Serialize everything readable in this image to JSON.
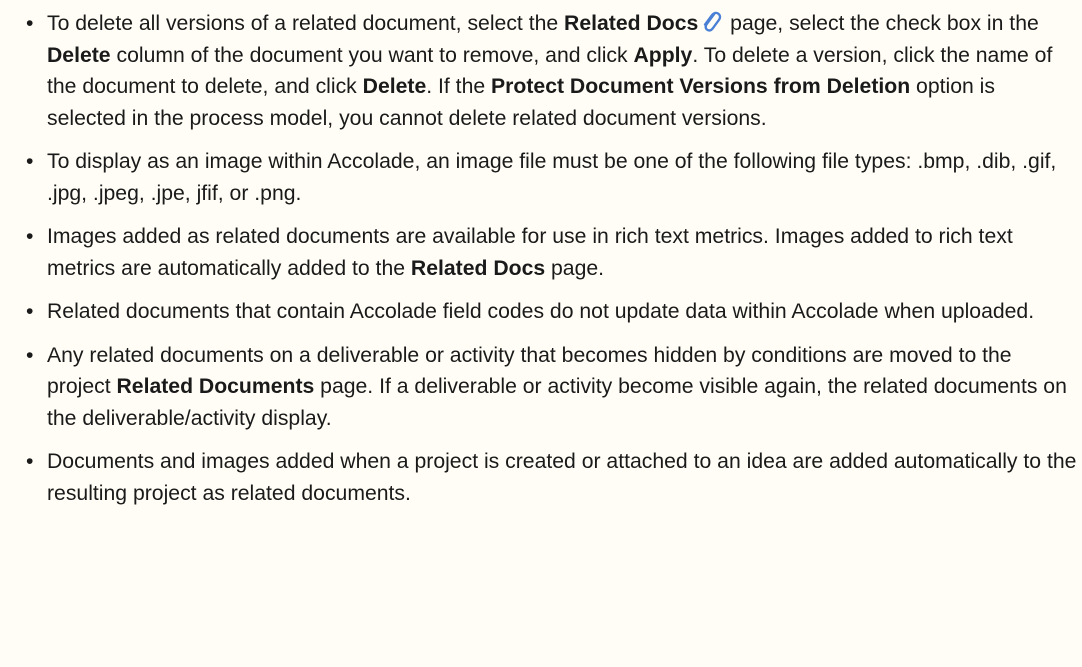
{
  "bullets": [
    {
      "segments": [
        {
          "t": "To delete all versions of a related document, select the "
        },
        {
          "t": "Related Docs",
          "b": true
        },
        {
          "icon": "paperclip-icon"
        },
        {
          "t": " page, select the check box in the "
        },
        {
          "t": "Delete",
          "b": true
        },
        {
          "t": " column of the document you want to remove, and click "
        },
        {
          "t": "Apply",
          "b": true
        },
        {
          "t": ". To delete a version, click the name of the document to delete, and click "
        },
        {
          "t": "Delete",
          "b": true
        },
        {
          "t": ". If the "
        },
        {
          "t": "Protect Document Versions from Deletion",
          "b": true
        },
        {
          "t": " option is selected in the process model, you cannot delete related document versions."
        }
      ]
    },
    {
      "segments": [
        {
          "t": "To display as an image within Accolade, an image file must be one of the following file types: .bmp, .dib, .gif, .jpg, .jpeg, .jpe, jfif, or .png."
        }
      ]
    },
    {
      "segments": [
        {
          "t": "Images added as related documents are available for use in rich text metrics. Images added to rich text metrics are automatically added to the "
        },
        {
          "t": "Related Docs",
          "b": true
        },
        {
          "t": " page."
        }
      ]
    },
    {
      "segments": [
        {
          "t": "Related documents that contain Accolade field codes do not update data within Accolade when uploaded."
        }
      ]
    },
    {
      "segments": [
        {
          "t": "Any related documents on a deliverable or activity that becomes hidden by conditions are moved to the project "
        },
        {
          "t": "Related Documents",
          "b": true
        },
        {
          "t": " page. If a deliverable or activity become visible again, the related documents on the deliverable/activity display."
        }
      ]
    },
    {
      "segments": [
        {
          "t": "Documents and images added when a project is created or attached to an idea are added automatically to the resulting project as related documents."
        }
      ]
    }
  ],
  "colors": {
    "background": "#fffdf5",
    "text": "#1a1a1a",
    "paperclip": "#4a7fd6"
  }
}
